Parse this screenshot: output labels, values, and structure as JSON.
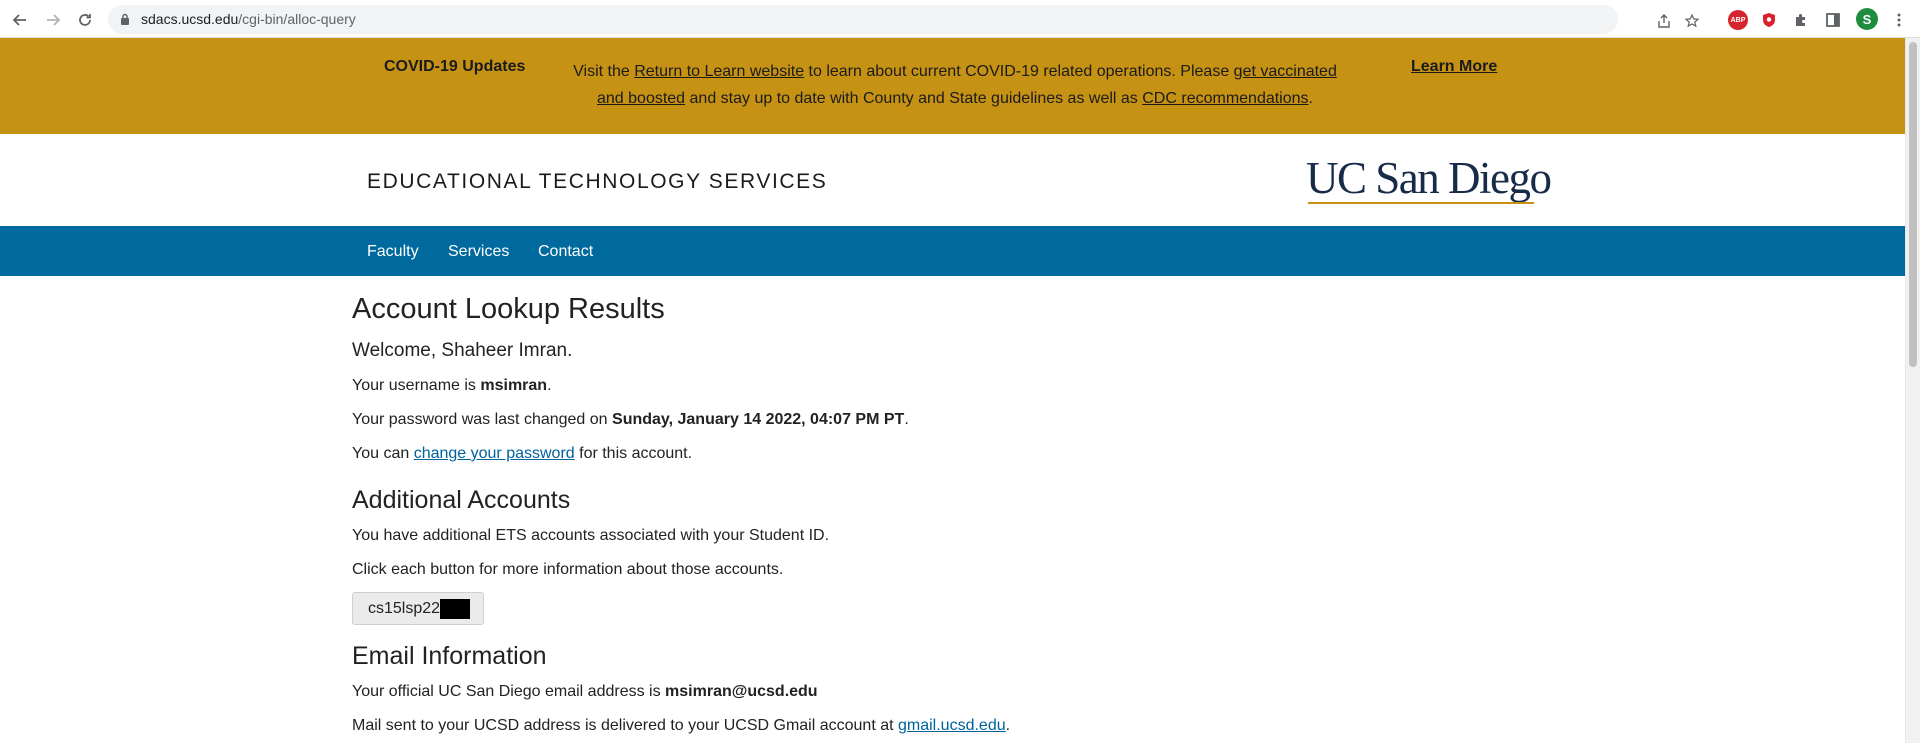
{
  "browser": {
    "url_host": "sdacs.ucsd.edu",
    "url_path": "/cgi-bin/alloc-query",
    "profile_initial": "S",
    "abp_label": "ABP"
  },
  "banner": {
    "title": "COVID-19 Updates",
    "msg_1": "Visit the ",
    "link_return": "Return to Learn website",
    "msg_2": " to learn about current COVID-19 related operations. Please ",
    "link_vaccinated": "get vaccinated and boosted",
    "msg_3": " and stay up to date with County and State guidelines as well as ",
    "link_cdc": "CDC recommendations",
    "msg_4": ".",
    "learn_more": "Learn More"
  },
  "header": {
    "site_title": "EDUCATIONAL TECHNOLOGY SERVICES",
    "logo_text": "UC San Diego"
  },
  "nav": {
    "items": [
      "Faculty",
      "Services",
      "Contact"
    ]
  },
  "account": {
    "heading": "Account Lookup Results",
    "welcome": "Welcome, Shaheer Imran.",
    "username_prefix": "Your username is ",
    "username": "msimran",
    "username_suffix": ".",
    "pw_prefix": "Your password was last changed on ",
    "pw_date": "Sunday, January 14 2022, 04:07 PM PT",
    "pw_suffix": ".",
    "change_prefix": "You can ",
    "change_link": "change your password",
    "change_suffix": " for this account."
  },
  "additional": {
    "heading": "Additional Accounts",
    "line1": "You have additional ETS accounts associated with your Student ID.",
    "line2": "Click each button for more information about those accounts.",
    "button_label": "cs15lsp22"
  },
  "email": {
    "heading": "Email Information",
    "addr_prefix": "Your official UC San Diego email address is ",
    "address": "msimran@ucsd.edu",
    "gmail_prefix": "Mail sent to your UCSD address is delivered to your UCSD Gmail account at ",
    "gmail_link": "gmail.ucsd.edu",
    "gmail_suffix": "."
  },
  "colors": {
    "banner_bg": "#c69214",
    "nav_bg": "#006a9e",
    "link": "#00629b",
    "logo_navy": "#182b49"
  }
}
